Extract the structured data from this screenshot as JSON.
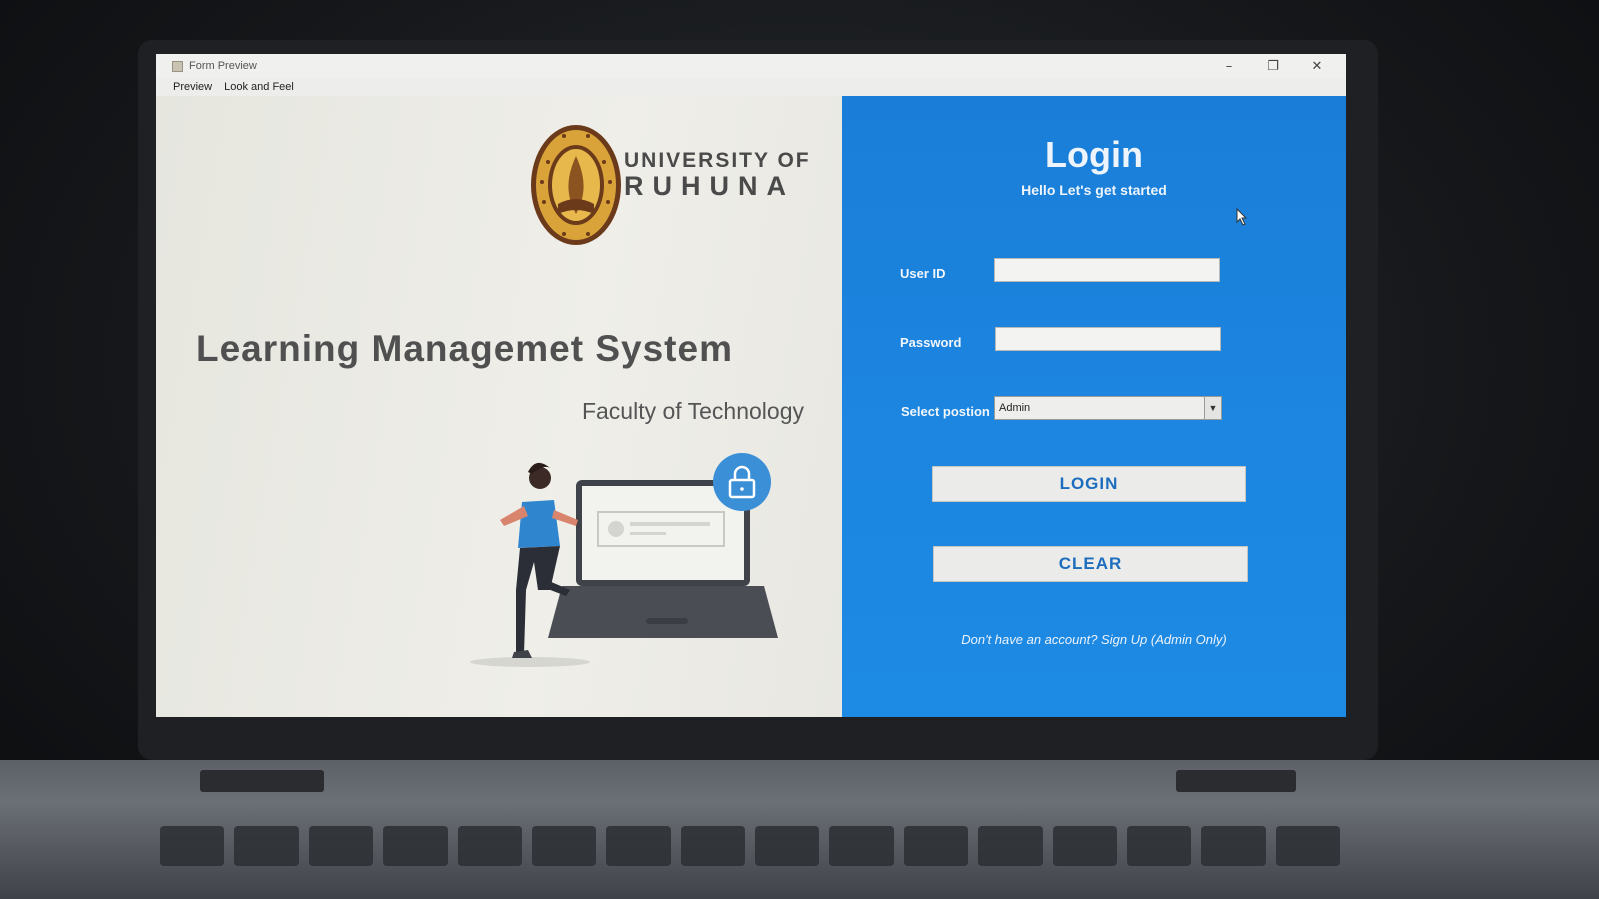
{
  "window": {
    "title": "Form Preview",
    "controls": {
      "minimize": "–",
      "maximize": "❐",
      "close": "✕"
    }
  },
  "menu": [
    {
      "label": "Preview"
    },
    {
      "label": "Look and Feel"
    }
  ],
  "branding": {
    "university_line1": "UNIVERSITY OF",
    "university_line2": "RUHUNA",
    "system_title": "Learning Managemet System",
    "faculty": "Faculty of Technology"
  },
  "login": {
    "title": "Login",
    "subtitle": "Hello Let's get started",
    "user_id_label": "User ID",
    "user_id_value": "",
    "password_label": "Password",
    "password_value": "",
    "position_label": "Select postion",
    "position_value": "Admin",
    "login_button": "LOGIN",
    "clear_button": "CLEAR",
    "signup_text": "Don't have an account? Sign Up (Admin Only)"
  },
  "colors": {
    "panel_blue": "#1c86e0",
    "button_text": "#1c6dbd",
    "title_gray": "#505050",
    "logo_gold": "#c9962a",
    "logo_brown": "#6b3a1a"
  }
}
